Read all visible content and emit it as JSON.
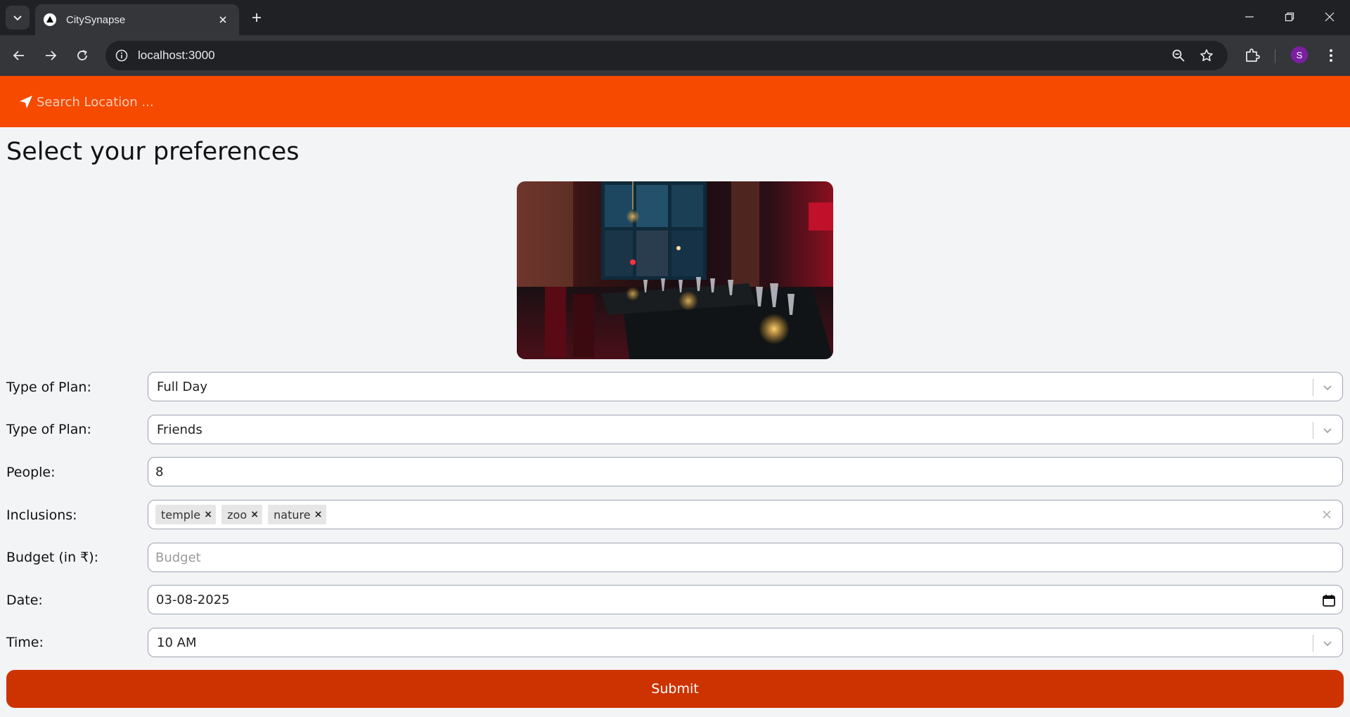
{
  "browser": {
    "tab_title": "CitySynapse",
    "url": "localhost:3000",
    "profile_initial": "S"
  },
  "header": {
    "search_placeholder": "Search Location ..."
  },
  "page": {
    "title": "Select your preferences",
    "image_icon": "restaurant-photo"
  },
  "form": {
    "plan_type": {
      "label": "Type of Plan:",
      "value": "Full Day"
    },
    "group_type": {
      "label": "Type of Plan:",
      "value": "Friends"
    },
    "people": {
      "label": "People:",
      "value": "8"
    },
    "inclusions": {
      "label": "Inclusions:",
      "tags": [
        "temple",
        "zoo",
        "nature"
      ]
    },
    "budget": {
      "label": "Budget (in ₹):",
      "value": "",
      "placeholder": "Budget"
    },
    "date": {
      "label": "Date:",
      "value": "03-08-2025"
    },
    "time": {
      "label": "Time:",
      "value": "10 AM"
    },
    "submit_label": "Submit"
  },
  "colors": {
    "header_bg": "#f64a00",
    "submit_bg": "#cc3300",
    "page_bg": "#f3f4f6"
  }
}
